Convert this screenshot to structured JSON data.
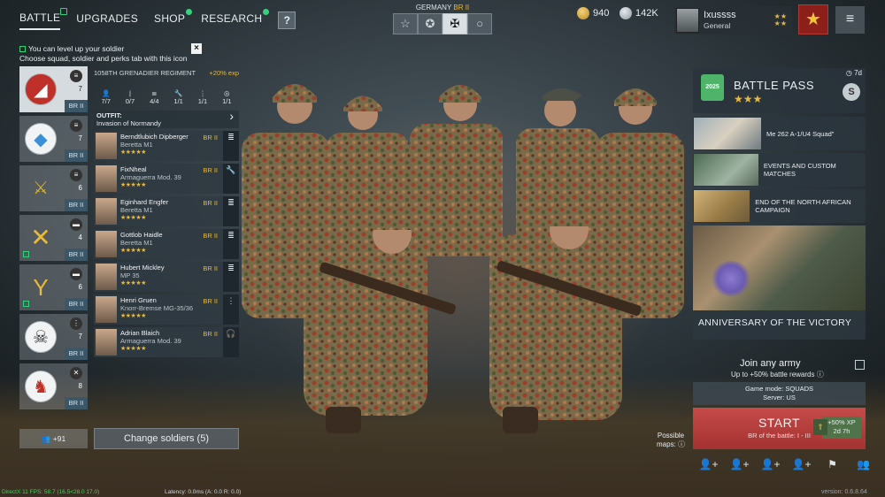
{
  "nav": {
    "tabs": [
      {
        "label": "BATTLE",
        "active": true
      },
      {
        "label": "UPGRADES"
      },
      {
        "label": "SHOP"
      },
      {
        "label": "RESEARCH"
      }
    ],
    "help_label": "?"
  },
  "hint": {
    "line1": "You can level up your soldier",
    "line2": "Choose squad, soldier and perks tab with this icon",
    "close": "×"
  },
  "nation": {
    "name": "GERMANY",
    "br": "BR II",
    "tabs": [
      "☆",
      "✪",
      "✠",
      "○"
    ]
  },
  "currency": {
    "gold": "940",
    "silver": "142K"
  },
  "profile": {
    "name": "Ixussss",
    "rank": "General",
    "badge_icon": "rank-star"
  },
  "menu_icon": "≡",
  "squads": [
    {
      "count": "7",
      "br": "BR II",
      "emblem": "shield-icon",
      "class_icon": "rifle-icon",
      "active": true
    },
    {
      "count": "7",
      "br": "BR II",
      "emblem": "blue-shield-icon",
      "class_icon": "rifle-icon"
    },
    {
      "count": "6",
      "br": "BR II",
      "emblem": "sword-icon",
      "class_icon": "rifle-icon"
    },
    {
      "count": "4",
      "br": "BR II",
      "emblem": "crossed-swords-icon",
      "class_icon": "tank-icon"
    },
    {
      "count": "6",
      "br": "BR II",
      "emblem": "fork-icon",
      "class_icon": "tank-icon"
    },
    {
      "count": "7",
      "br": "BR II",
      "emblem": "skull-icon",
      "class_icon": "mg-icon"
    },
    {
      "count": "8",
      "br": "BR II",
      "emblem": "knight-icon",
      "class_icon": "engineer-icon"
    }
  ],
  "squad_footer": "+91",
  "regiment": {
    "name": "1058TH GRENADIER REGIMENT",
    "exp": "+20% exp",
    "stats": [
      "7/7",
      "0/7",
      "4/4",
      "1/1",
      "1/1",
      "1/1"
    ],
    "outfit_label": "OUTFIT:",
    "outfit_value": "Invasion of Normandy"
  },
  "soldiers": [
    {
      "name": "Berndtlubich Dipberger",
      "weapon": "Beretta M1",
      "br": "BR II",
      "stars": "★★★★★",
      "side": "≣"
    },
    {
      "name": "FixNheal",
      "weapon": "Armaguerra Mod. 39",
      "br": "BR II",
      "stars": "★★★★★",
      "side": "🔧"
    },
    {
      "name": "Eginhard Engfer",
      "weapon": "Beretta M1",
      "br": "BR II",
      "stars": "★★★★★",
      "side": "≣"
    },
    {
      "name": "Gottlob Haidle",
      "weapon": "Beretta M1",
      "br": "BR II",
      "stars": "★★★★★",
      "side": "≣"
    },
    {
      "name": "Hubert Mickley",
      "weapon": "MP 35",
      "br": "BR II",
      "stars": "★★★★★",
      "side": "≣"
    },
    {
      "name": "Henri Gruen",
      "weapon": "Knorr-Bremse MG-35/36",
      "br": "BR II",
      "stars": "★★★★★",
      "side": "⋮"
    },
    {
      "name": "Adrian Blaich",
      "weapon": "Armaguerra Mod. 39",
      "br": "BR II",
      "stars": "★★★★★",
      "side": "🎧"
    }
  ],
  "change_button": "Change soldiers (5)",
  "battle_pass": {
    "title": "BATTLE PASS",
    "stars": "★★★",
    "time": "7d",
    "badge": "S",
    "icon_label": "2025"
  },
  "promos": [
    {
      "text": "Me 262 A-1/U4 Squad\""
    },
    {
      "text": "EVENTS AND CUSTOM MATCHES"
    },
    {
      "text": "END OF THE NORTH AFRICAN CAMPAIGN"
    }
  ],
  "big_promo": {
    "title": "ANNIVERSARY OF THE VICTORY"
  },
  "join": {
    "label": "Join any army",
    "sub": "Up to +50% battle rewards"
  },
  "mode": {
    "line1": "Game mode: SQUADS",
    "line2": "Server: US"
  },
  "start": {
    "label": "START",
    "sub": "BR of the battle: I - III"
  },
  "xp": {
    "line1": "+50% XP",
    "line2": "2d 7h"
  },
  "maps": {
    "line1": "Possible",
    "line2": "maps:"
  },
  "bottom_icons": [
    "👤+",
    "👤+",
    "👤+",
    "👤+",
    "⚑",
    "👥"
  ],
  "debug": "DirectX 11 FPS: 58.7 (16.5<28.0 17.0)",
  "latency": "Latency: 0.0ms (A: 0.0 R: 0.0)",
  "version": "version: 0.6.8.64",
  "colors": {
    "accent_gold": "#e8b93a",
    "start_red": "#b23b39",
    "new_green": "#36d27a"
  }
}
